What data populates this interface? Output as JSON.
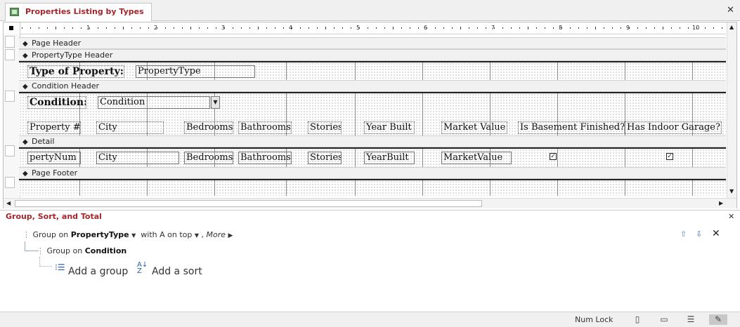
{
  "tab": {
    "title": "Properties Listing by Types"
  },
  "designer": {
    "ruler_numbers": [
      "1",
      "2",
      "3",
      "4",
      "5",
      "6",
      "7",
      "8",
      "9",
      "10"
    ],
    "sections": {
      "page_header": "Page Header",
      "propertytype_header": "PropertyType Header",
      "condition_header": "Condition Header",
      "detail": "Detail",
      "page_footer": "Page Footer"
    },
    "controls": {
      "type_label": "Type of Property:",
      "type_field": "PropertyType",
      "condition_label": "Condition:",
      "condition_field": "Condition",
      "col_property": "Property #",
      "col_city": "City",
      "col_bedrooms": "Bedrooms",
      "col_bathrooms": "Bathrooms",
      "col_stories": "Stories",
      "col_yearbuilt": "Year Built",
      "col_marketvalue": "Market Value",
      "col_basement": "Is Basement Finished?",
      "col_garage": "Has Indoor Garage?",
      "fld_property": "pertyNum",
      "fld_city": "City",
      "fld_bedrooms": "Bedrooms",
      "fld_bathrooms": "Bathrooms",
      "fld_stories": "Stories",
      "fld_yearbuilt": "YearBuilt",
      "fld_marketvalue": "MarketValue",
      "basement_checked": true,
      "garage_checked": true
    }
  },
  "group_panel": {
    "title": "Group, Sort, and Total",
    "row1": {
      "prefix": "Group on",
      "field": "PropertyType",
      "sort": "with A on top",
      "separator": ",",
      "more": "More"
    },
    "row2": {
      "prefix": "Group on",
      "field": "Condition"
    },
    "add_group": "Add a group",
    "add_sort": "Add a sort"
  },
  "status": {
    "num_lock": "Num Lock"
  }
}
